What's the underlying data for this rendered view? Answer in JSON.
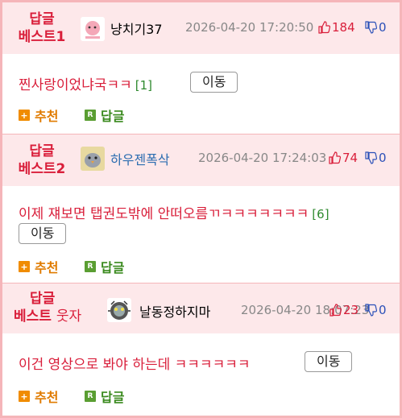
{
  "posts": [
    {
      "badge_line1": "답글",
      "badge_line2": "베스트1",
      "badge_suffix": "",
      "nickname": "냥치기37",
      "nick_color": "#222222",
      "date": "2026-04-20 17:20:50",
      "up": "184",
      "down": "0",
      "text": "찐사랑이었냐국ㅋㅋ",
      "reply_count": "[1]",
      "move_label": "이동",
      "recommend_label": "추천",
      "reply_label": "답글",
      "recommend_icon": "plus-icon",
      "reply_icon": "r-badge-icon"
    },
    {
      "badge_line1": "답글",
      "badge_line2": "베스트2",
      "badge_suffix": "",
      "nickname": "하우젠폭삭",
      "nick_color": "#2b6cb0",
      "date": "2026-04-20 17:24:03",
      "up": "74",
      "down": "0",
      "text": "이제 쟤보면 탭권도밖에 안떠오름ㄲㅋㅋㅋㅋㅋㅋㅋ",
      "reply_count": "[6]",
      "move_label": "이동",
      "recommend_label": "추천",
      "reply_label": "답글",
      "recommend_icon": "plus-icon",
      "reply_icon": "r-badge-icon"
    },
    {
      "badge_line1": "답글",
      "badge_line2": "베스트",
      "badge_suffix": "웃자",
      "nickname": "날동정하지마",
      "nick_color": "#222222",
      "date": "2026-04-20 18:07:23",
      "up": "23",
      "down": "0",
      "text": "이건 영상으로 봐야 하는데 ㅋㅋㅋㅋㅋㅋ",
      "reply_count": "",
      "move_label": "이동",
      "recommend_label": "추천",
      "reply_label": "답글",
      "recommend_icon": "plus-icon",
      "reply_icon": "r-badge-icon"
    }
  ],
  "colors": {
    "accent": "#d91e3a",
    "border": "#f5b5b9",
    "header_bg": "#fde8ea"
  }
}
